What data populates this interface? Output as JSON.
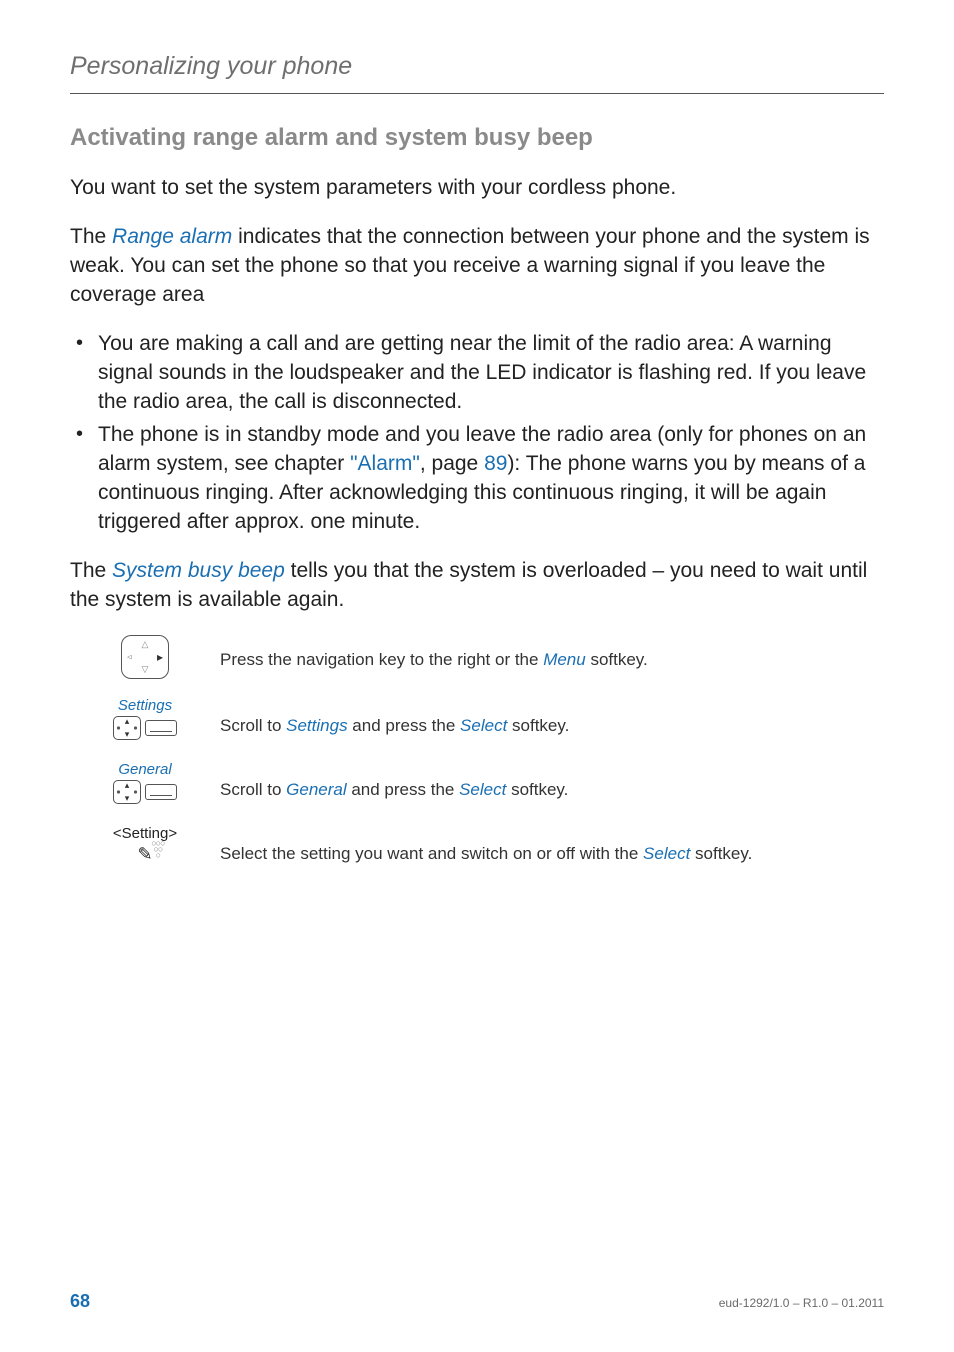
{
  "running_head": "Personalizing your phone",
  "heading": "Activating range alarm and system busy beep",
  "intro1": "You want to set the system parameters with your cordless phone.",
  "intro2_pre": "The ",
  "intro2_term": "Range alarm",
  "intro2_post": " indicates that the connection between your phone and the system is weak. You can set the phone so that you receive a warning signal if you leave the coverage area",
  "bullet1": "You are making a call and are getting near the limit of the radio area: A warning signal sounds in the loudspeaker and the LED indicator is flashing red. If you leave the radio area, the call is disconnected.",
  "bullet2_a": "The phone is in standby mode and you leave the radio area (only for phones on an alarm system, see chapter ",
  "bullet2_link": "\"Alarm\"",
  "bullet2_b": ", page ",
  "bullet2_page": "89",
  "bullet2_c": "): The phone warns you by means of a continuous ringing. After acknowledging this continuous ringing, it will be again triggered after approx. one minute.",
  "para3_pre": "The ",
  "para3_term": "System busy beep",
  "para3_post": " tells you that the system is overloaded – you need to wait until the system is available again.",
  "steps": {
    "s1_text_a": "Press the navigation key to the right or the ",
    "s1_text_menu": "Menu",
    "s1_text_b": " softkey.",
    "s2_caption": "Settings",
    "s2_text_a": "Scroll to ",
    "s2_text_term": "Settings",
    "s2_text_b": " and press the ",
    "s2_text_select": "Select",
    "s2_text_c": " softkey.",
    "s3_caption": "General",
    "s3_text_a": "Scroll to ",
    "s3_text_term": "General",
    "s3_text_b": " and press the ",
    "s3_text_select": "Select",
    "s3_text_c": " softkey.",
    "s4_caption": "<Setting>",
    "s4_text_a": "Select the setting you want and switch on or off with the ",
    "s4_text_select": "Select",
    "s4_text_b": " softkey."
  },
  "footer": {
    "page": "68",
    "docid": "eud-1292/1.0 – R1.0 – 01.2011"
  }
}
